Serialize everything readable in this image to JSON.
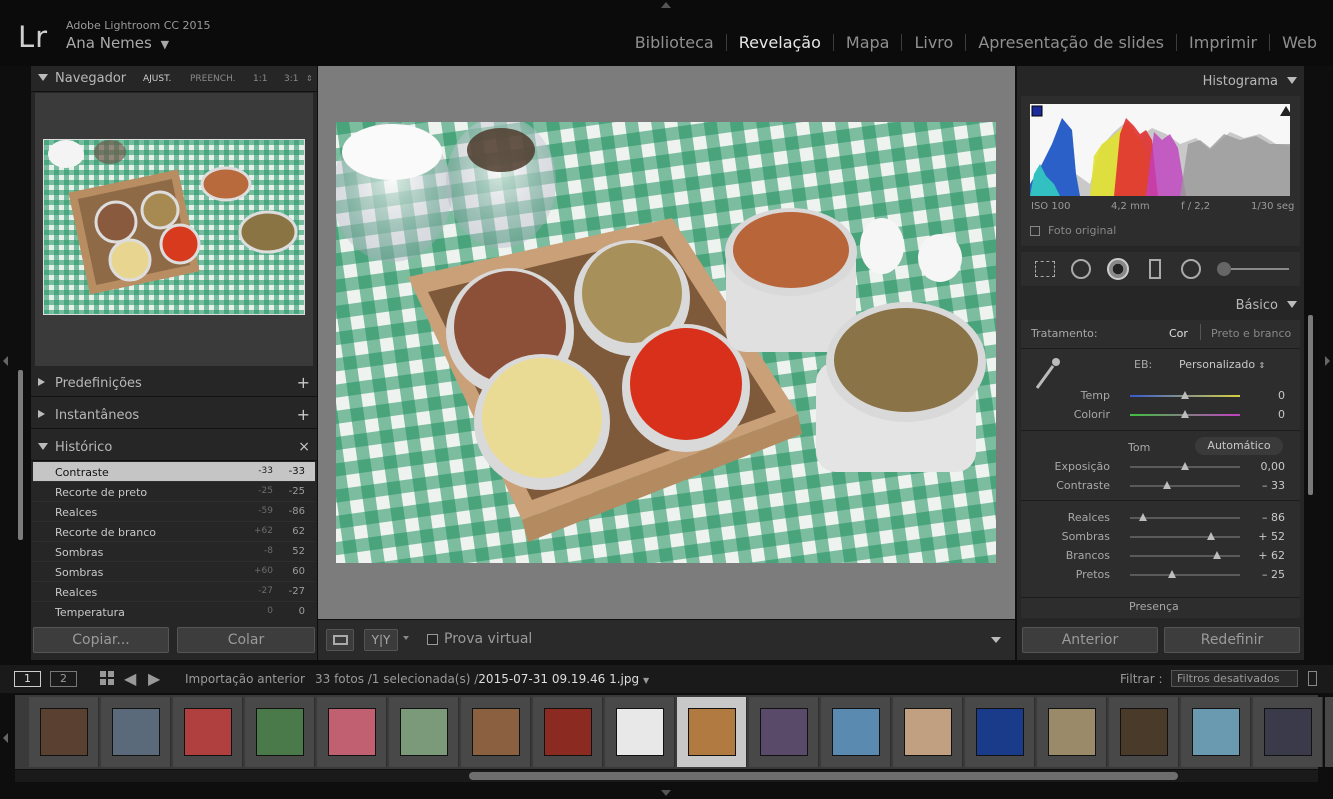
{
  "app": {
    "logo": "Lr",
    "name": "Adobe Lightroom CC 2015",
    "user": "Ana Nemes",
    "user_chevron": "▼"
  },
  "modules": [
    {
      "label": "Biblioteca",
      "active": false
    },
    {
      "label": "Revelação",
      "active": true
    },
    {
      "label": "Mapa",
      "active": false
    },
    {
      "label": "Livro",
      "active": false
    },
    {
      "label": "Apresentação de slides",
      "active": false
    },
    {
      "label": "Imprimir",
      "active": false
    },
    {
      "label": "Web",
      "active": false
    }
  ],
  "left_panel": {
    "navigator": {
      "title": "Navegador",
      "options": [
        "AJUST.",
        "PREENCH.",
        "1:1",
        "3:1"
      ]
    },
    "presets": {
      "title": "Predefinições",
      "action": "+"
    },
    "snapshots": {
      "title": "Instantâneos",
      "action": "+"
    },
    "history": {
      "title": "Histórico",
      "action": "×",
      "items": [
        {
          "name": "Contraste",
          "delta": "-33",
          "value": "-33",
          "selected": true
        },
        {
          "name": "Recorte de preto",
          "delta": "-25",
          "value": "-25"
        },
        {
          "name": "Realces",
          "delta": "-59",
          "value": "-86"
        },
        {
          "name": "Recorte de branco",
          "delta": "+62",
          "value": "62"
        },
        {
          "name": "Sombras",
          "delta": "-8",
          "value": "52"
        },
        {
          "name": "Sombras",
          "delta": "+60",
          "value": "60"
        },
        {
          "name": "Realces",
          "delta": "-27",
          "value": "-27"
        },
        {
          "name": "Temperatura",
          "delta": "0",
          "value": "0"
        }
      ]
    },
    "copy_button": "Copiar...",
    "paste_button": "Colar"
  },
  "toolbar": {
    "compare_label": "Y|Y",
    "soft_proof_label": "Prova virtual"
  },
  "right_panel": {
    "histogram": {
      "title": "Histograma",
      "iso": "ISO 100",
      "focal": "4,2 mm",
      "aperture": "f / 2,2",
      "shutter": "1/30 seg",
      "original_photo": "Foto original"
    },
    "basic": {
      "title": "Básico",
      "treatment_label": "Tratamento:",
      "treatment_color": "Cor",
      "treatment_bw": "Preto e branco",
      "wb_label": "EB:",
      "wb_value": "Personalizado",
      "tone_label": "Tom",
      "auto_label": "Automático",
      "presence_label": "Presença",
      "sliders": [
        {
          "name": "Temp",
          "value": "0",
          "pos": 0.5
        },
        {
          "name": "Colorir",
          "value": "0",
          "pos": 0.5
        },
        {
          "name": "Exposição",
          "value": "0,00",
          "pos": 0.5
        },
        {
          "name": "Contraste",
          "value": "– 33",
          "pos": 0.34
        },
        {
          "name": "Realces",
          "value": "– 86",
          "pos": 0.12
        },
        {
          "name": "Sombras",
          "value": "+ 52",
          "pos": 0.74
        },
        {
          "name": "Brancos",
          "value": "+ 62",
          "pos": 0.79
        },
        {
          "name": "Pretos",
          "value": "– 25",
          "pos": 0.38
        }
      ]
    },
    "previous_button": "Anterior",
    "reset_button": "Redefinir"
  },
  "filmstrip_bar": {
    "view1": "1",
    "view2": "2",
    "source": "Importação anterior",
    "count": "33 fotos /1 selecionada(s) /",
    "filename": "2015-07-31 09.19.46 1.jpg",
    "filter_label": "Filtrar :",
    "filter_value": "Filtros desativados"
  },
  "colors": {
    "accent": "#e6e6e6",
    "panel": "#262626",
    "canvas": "#7c7c7c"
  }
}
